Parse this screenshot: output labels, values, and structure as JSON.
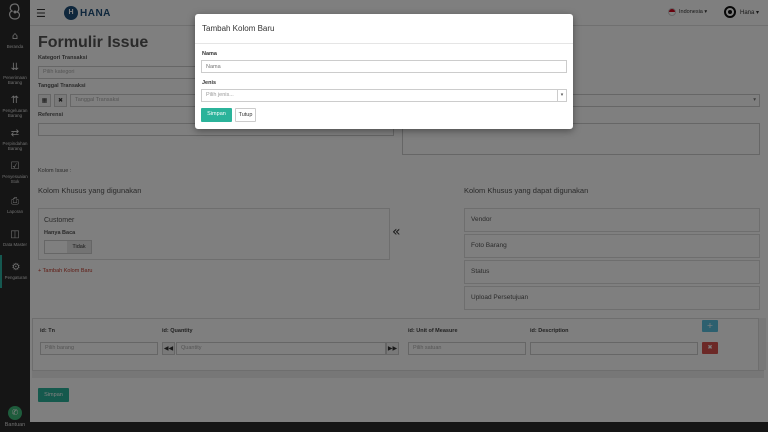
{
  "sidebar": {
    "logo_icon": "app-logo-icon",
    "items": [
      {
        "label": "Beranda",
        "icon": "home-icon"
      },
      {
        "label": "Penerimaan Barang",
        "icon": "chevrons-down-icon"
      },
      {
        "label": "Pengeluaran Barang",
        "icon": "chevrons-up-icon"
      },
      {
        "label": "Perpindahan Barang",
        "icon": "exchange-icon"
      },
      {
        "label": "Penyesuaian Stok",
        "icon": "checkbox-icon"
      },
      {
        "label": "Laporan",
        "icon": "print-icon"
      },
      {
        "label": "Data Master",
        "icon": "box-icon"
      },
      {
        "label": "Pengaturan",
        "icon": "gears-icon"
      }
    ],
    "help_label": "Bantuan"
  },
  "topbar": {
    "brand": "HANA",
    "language": "Indonesia ▾",
    "user": "Hana ▾"
  },
  "form": {
    "title": "Formulir Issue",
    "kategori_label": "Kategori Transaksi",
    "kategori_placeholder": "Pilih kategori",
    "tanggal_label": "Tanggal Transaksi",
    "tanggal_placeholder": "Tanggal Transaksi",
    "referensi_label": "Referensi",
    "kolom_issue_label": "Kolom Issue :",
    "used_title": "Kolom Khusus yang digunakan",
    "available_title": "Kolom Khusus yang dapat digunakan",
    "used_card": {
      "title": "Customer",
      "read_only_label": "Hanya Baca",
      "toggle_off": "Tidak"
    },
    "add_column_link": "+ Tambah Kolom Baru",
    "available_items": [
      "Vendor",
      "Foto Barang",
      "Status",
      "Upload Persetujuan"
    ],
    "table": {
      "headers": [
        "id: Tn",
        "id: Quantity",
        "id: Unit of Measure",
        "id: Description"
      ],
      "item_placeholder": "Pilih barang",
      "quantity_placeholder": "Quantity",
      "unit_placeholder": "Pilih satuan"
    },
    "save_label": "Simpan"
  },
  "modal": {
    "title": "Tambah Kolom Baru",
    "name_label": "Nama",
    "name_placeholder": "Nama",
    "type_label": "Jenis",
    "type_placeholder": "Pilih jenis...",
    "save_label": "Simpan",
    "close_label": "Tutup"
  },
  "colors": {
    "accent": "#2bb39a",
    "sidebar": "#2b2b2b",
    "brand": "#1f4e79",
    "add_row": "#5bc0de",
    "delete_row": "#d9534f"
  }
}
